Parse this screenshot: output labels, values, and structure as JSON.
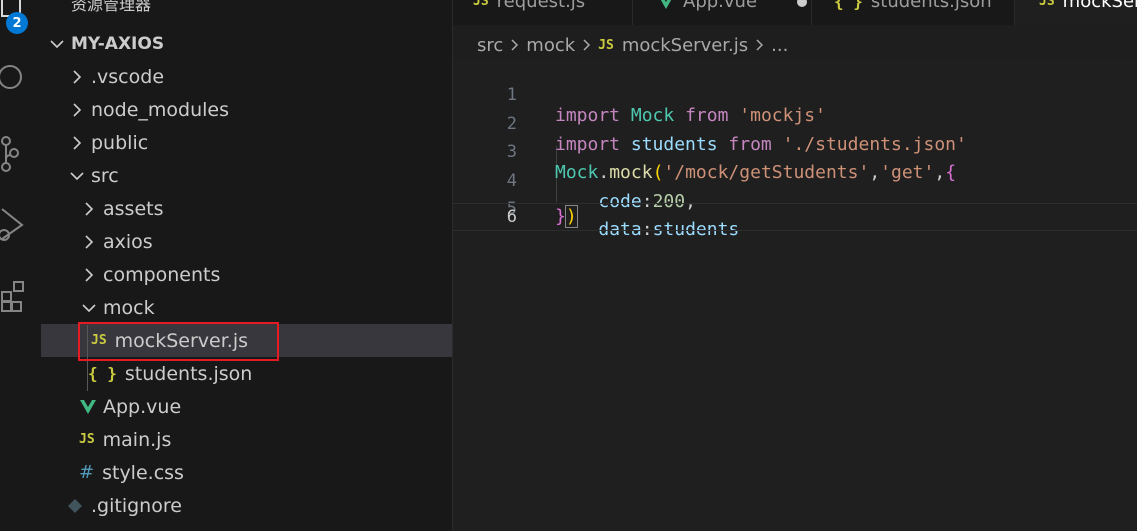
{
  "sidebar": {
    "title": "资源管理器",
    "more": "···",
    "root": "MY-AXIOS",
    "items": [
      {
        "label": ".vscode",
        "kind": "folder",
        "expanded": false,
        "depth": 1
      },
      {
        "label": "node_modules",
        "kind": "folder",
        "expanded": false,
        "depth": 1
      },
      {
        "label": "public",
        "kind": "folder",
        "expanded": false,
        "depth": 1
      },
      {
        "label": "src",
        "kind": "folder",
        "expanded": true,
        "depth": 1
      },
      {
        "label": "assets",
        "kind": "folder",
        "expanded": false,
        "depth": 2
      },
      {
        "label": "axios",
        "kind": "folder",
        "expanded": false,
        "depth": 2
      },
      {
        "label": "components",
        "kind": "folder",
        "expanded": false,
        "depth": 2
      },
      {
        "label": "mock",
        "kind": "folder",
        "expanded": true,
        "depth": 2
      },
      {
        "label": "mockServer.js",
        "kind": "js",
        "icon": "JS",
        "depth": 3,
        "selected": true
      },
      {
        "label": "students.json",
        "kind": "json",
        "icon": "{ }",
        "depth": 3
      },
      {
        "label": "App.vue",
        "kind": "vue",
        "depth": 2
      },
      {
        "label": "main.js",
        "kind": "js",
        "icon": "JS",
        "depth": 2
      },
      {
        "label": "style.css",
        "kind": "css",
        "icon": "#",
        "depth": 2
      },
      {
        "label": ".gitignore",
        "kind": "git",
        "depth": 1
      }
    ]
  },
  "activity": {
    "badge": "2"
  },
  "tabs": [
    {
      "label": "request.js",
      "icon": "JS"
    },
    {
      "label": "App.vue",
      "icon": "vue"
    },
    {
      "label": "students.json",
      "icon": "{ }"
    },
    {
      "label": "mockServer.js",
      "icon": "JS",
      "active": true
    }
  ],
  "breadcrumb": {
    "items": [
      "src",
      "mock",
      "mockServer.js",
      "..."
    ],
    "file_icon": "JS"
  },
  "editor": {
    "line_numbers": [
      "1",
      "2",
      "3",
      "4",
      "5",
      "6"
    ],
    "lines": [
      "import Mock from 'mockjs'",
      "import students from './students.json'",
      "Mock.mock('/mock/getStudents','get',{",
      "    code:200,",
      "    data:students",
      "})"
    ]
  },
  "colors": {
    "accent": "#0078d4",
    "highlight": "#e51b24",
    "js_icon": "#cbcb41",
    "vue_icon": "#41b883"
  }
}
